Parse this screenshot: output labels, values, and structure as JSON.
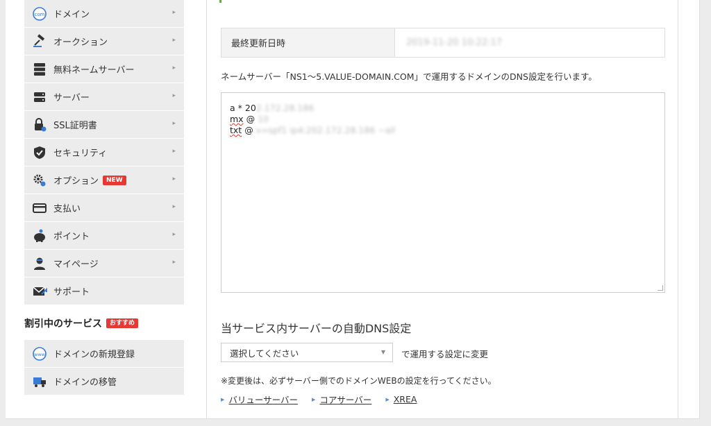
{
  "sidebar": {
    "items": [
      {
        "label": "ドメイン",
        "icon": "globe-com-icon"
      },
      {
        "label": "オークション",
        "icon": "gavel-icon"
      },
      {
        "label": "無料ネームサーバー",
        "icon": "server-stack-icon"
      },
      {
        "label": "サーバー",
        "icon": "server-icon"
      },
      {
        "label": "SSL証明書",
        "icon": "ssl-lock-icon"
      },
      {
        "label": "セキュリティ",
        "icon": "shield-icon"
      },
      {
        "label": "オプション",
        "icon": "gears-icon",
        "badge": "NEW"
      },
      {
        "label": "支払い",
        "icon": "card-icon"
      },
      {
        "label": "ポイント",
        "icon": "piggy-bank-icon"
      },
      {
        "label": "マイページ",
        "icon": "user-icon"
      },
      {
        "label": "サポート",
        "icon": "mail-icon"
      }
    ],
    "discount_title": "割引中のサービス",
    "discount_badge": "おすすめ",
    "discount_items": [
      {
        "label": "ドメインの新規登録",
        "icon": "www-globe-icon"
      },
      {
        "label": "ドメインの移管",
        "icon": "transfer-icon"
      }
    ]
  },
  "main": {
    "info_label": "最終更新日時",
    "info_value": "2019-11-20 10:22:17",
    "description": "ネームサーバー「NS1～5.VALUE-DOMAIN.COM」で運用するドメインのDNS設定を行います。",
    "dns_lines": [
      {
        "keyword": "a",
        "rest": "* 20",
        "blurred": "2.172.28.186"
      },
      {
        "keyword": "mx",
        "rest": "@ ",
        "blurred": "10"
      },
      {
        "keyword": "txt",
        "rest": "@ ",
        "blurred": "v=spf1 ip4:202.172.28.186 ~all"
      }
    ],
    "auto_dns_title": "当サービス内サーバーの自動DNS設定",
    "select_value": "選択してください",
    "select_suffix": "で運用する設定に変更",
    "note": "※変更後は、必ずサーバー側でのドメインWEBの設定を行ってください。",
    "links": [
      "バリューサーバー",
      "コアサーバー",
      "XREA"
    ]
  },
  "colors": {
    "accent_green": "#6aa84f",
    "badge_red": "#e53935",
    "link_blue": "#5b8dd6"
  }
}
